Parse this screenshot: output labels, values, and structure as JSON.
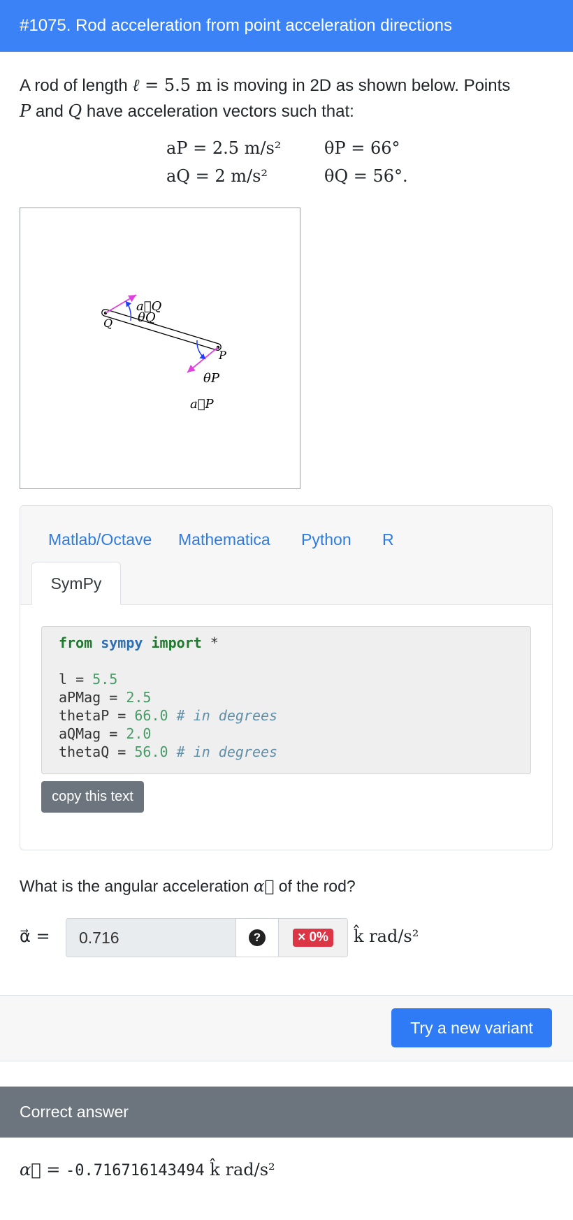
{
  "header": {
    "title": "#1075. Rod acceleration from point acceleration directions"
  },
  "intro": {
    "part1": "A rod of length ",
    "ell": "ℓ",
    "eq": " = ",
    "length": "5.5 m",
    "part2": " is moving in 2D as shown below. Points ",
    "P": "P",
    "and": " and ",
    "Q": "Q",
    "part3": " have acceleration vectors such that:"
  },
  "equations": {
    "aP": "aP = 2.5 m/s²",
    "aQ": "aQ = 2 m/s²",
    "thetaP": "θP = 66°",
    "thetaQ": "θQ = 56°."
  },
  "figure": {
    "label_aQ": "a⃗Q",
    "label_thetaQ": "θQ",
    "label_Q": "Q",
    "label_P": "P",
    "label_thetaP": "θP",
    "label_aP": "a⃗P",
    "colors": {
      "vector": "#e040e0",
      "angle": "#1f3cff",
      "rod": "#000000"
    },
    "angles_deg": {
      "thetaP": 66,
      "thetaQ": 56
    }
  },
  "tabs": [
    "Matlab/Octave",
    "Mathematica",
    "Python",
    "R"
  ],
  "active_tab": "SymPy",
  "code": {
    "import_from": "from",
    "import_module": "sympy",
    "import_kw": "import",
    "import_star": " *",
    "lines": [
      {
        "name": "l",
        "pad": " = ",
        "value": "5.5",
        "comment": ""
      },
      {
        "name": "aPMag",
        "pad": " = ",
        "value": "2.5",
        "comment": ""
      },
      {
        "name": "thetaP",
        "pad": " = ",
        "value": "66.0",
        "comment": " # in degrees"
      },
      {
        "name": "aQMag",
        "pad": " = ",
        "value": "2.0",
        "comment": ""
      },
      {
        "name": "thetaQ",
        "pad": " = ",
        "value": "56.0",
        "comment": " # in degrees"
      }
    ]
  },
  "copy_button": "copy this text",
  "question": {
    "text_before": "What is the angular acceleration ",
    "symbol": "α⃗",
    "text_after": " of the rod?"
  },
  "answer": {
    "label": "α⃗ =",
    "value": "0.716",
    "help": "?",
    "score": "× 0%",
    "unit": "k̂ rad/s²"
  },
  "variant_button": "Try a new variant",
  "correct": {
    "header": "Correct answer",
    "label": "α⃗ = ",
    "value": "-0.716716143494",
    "unit": " k̂ rad/s²"
  }
}
